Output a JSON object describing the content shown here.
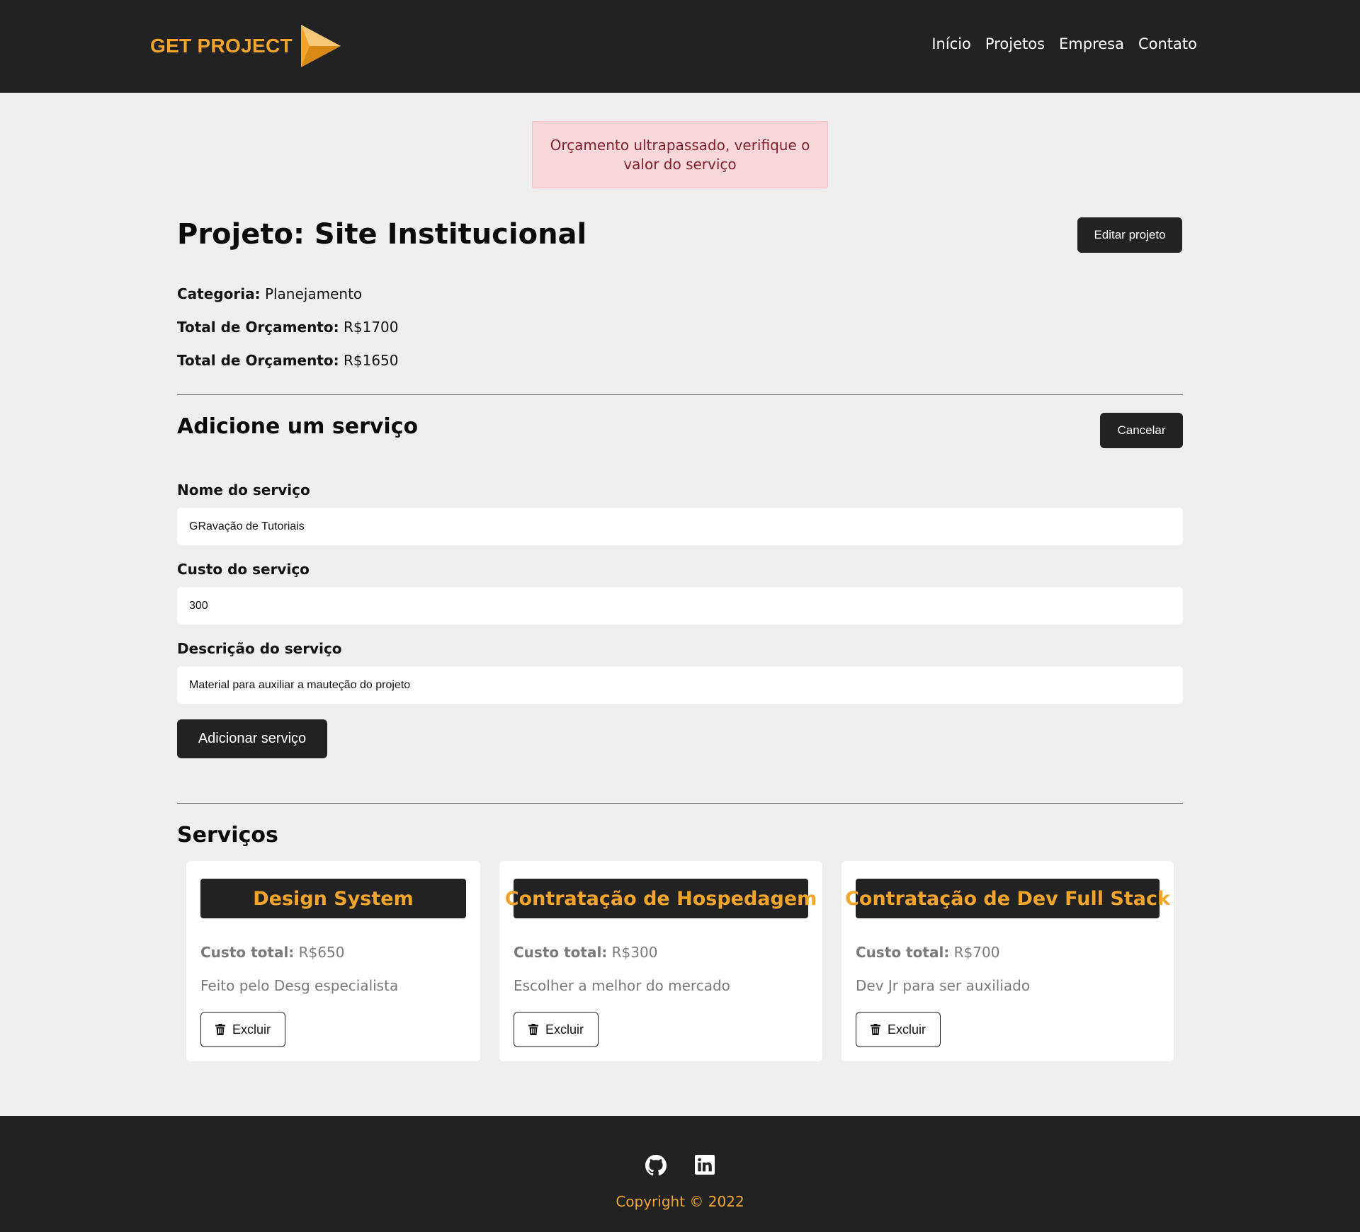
{
  "header": {
    "logo_text": "GET PROJECT",
    "nav": [
      "Início",
      "Projetos",
      "Empresa",
      "Contato"
    ]
  },
  "alert": {
    "message": "Orçamento ultrapassado, verifique o valor do serviço"
  },
  "project": {
    "title": "Projeto: Site Institucional",
    "edit_label": "Editar projeto",
    "category_label": "Categoria:",
    "category_value": "Planejamento",
    "budget_label": "Total de Orçamento:",
    "budget_value": "R$1700",
    "used_label": "Total de Orçamento:",
    "used_value": "R$1650"
  },
  "add_service": {
    "title": "Adicione um serviço",
    "cancel_label": "Cancelar",
    "name_label": "Nome do serviço",
    "name_value": "GRavação de Tutoriais",
    "cost_label": "Custo do serviço",
    "cost_value": "300",
    "desc_label": "Descrição do serviço",
    "desc_value": "Material para auxiliar a mauteção do projeto",
    "submit_label": "Adicionar serviço"
  },
  "services": {
    "title": "Serviços",
    "cost_label": "Custo total:",
    "delete_label": "Excluir",
    "items": [
      {
        "name": "Design System",
        "cost": "R$650",
        "description": "Feito pelo Desg especialista"
      },
      {
        "name": "Contratação de Hospedagem",
        "cost": "R$300",
        "description": "Escolher a melhor do mercado"
      },
      {
        "name": "Contratação de Dev Full Stack",
        "cost": "R$700",
        "description": "Dev Jr para ser auxiliado"
      }
    ]
  },
  "footer": {
    "icons": [
      "github-icon",
      "linkedin-icon"
    ],
    "copyright": "Copyright © 2022"
  },
  "colors": {
    "dark": "#222222",
    "accent": "#f2a52a",
    "background": "#efefef",
    "alert_bg": "#f8d7da",
    "alert_text": "#842029"
  }
}
